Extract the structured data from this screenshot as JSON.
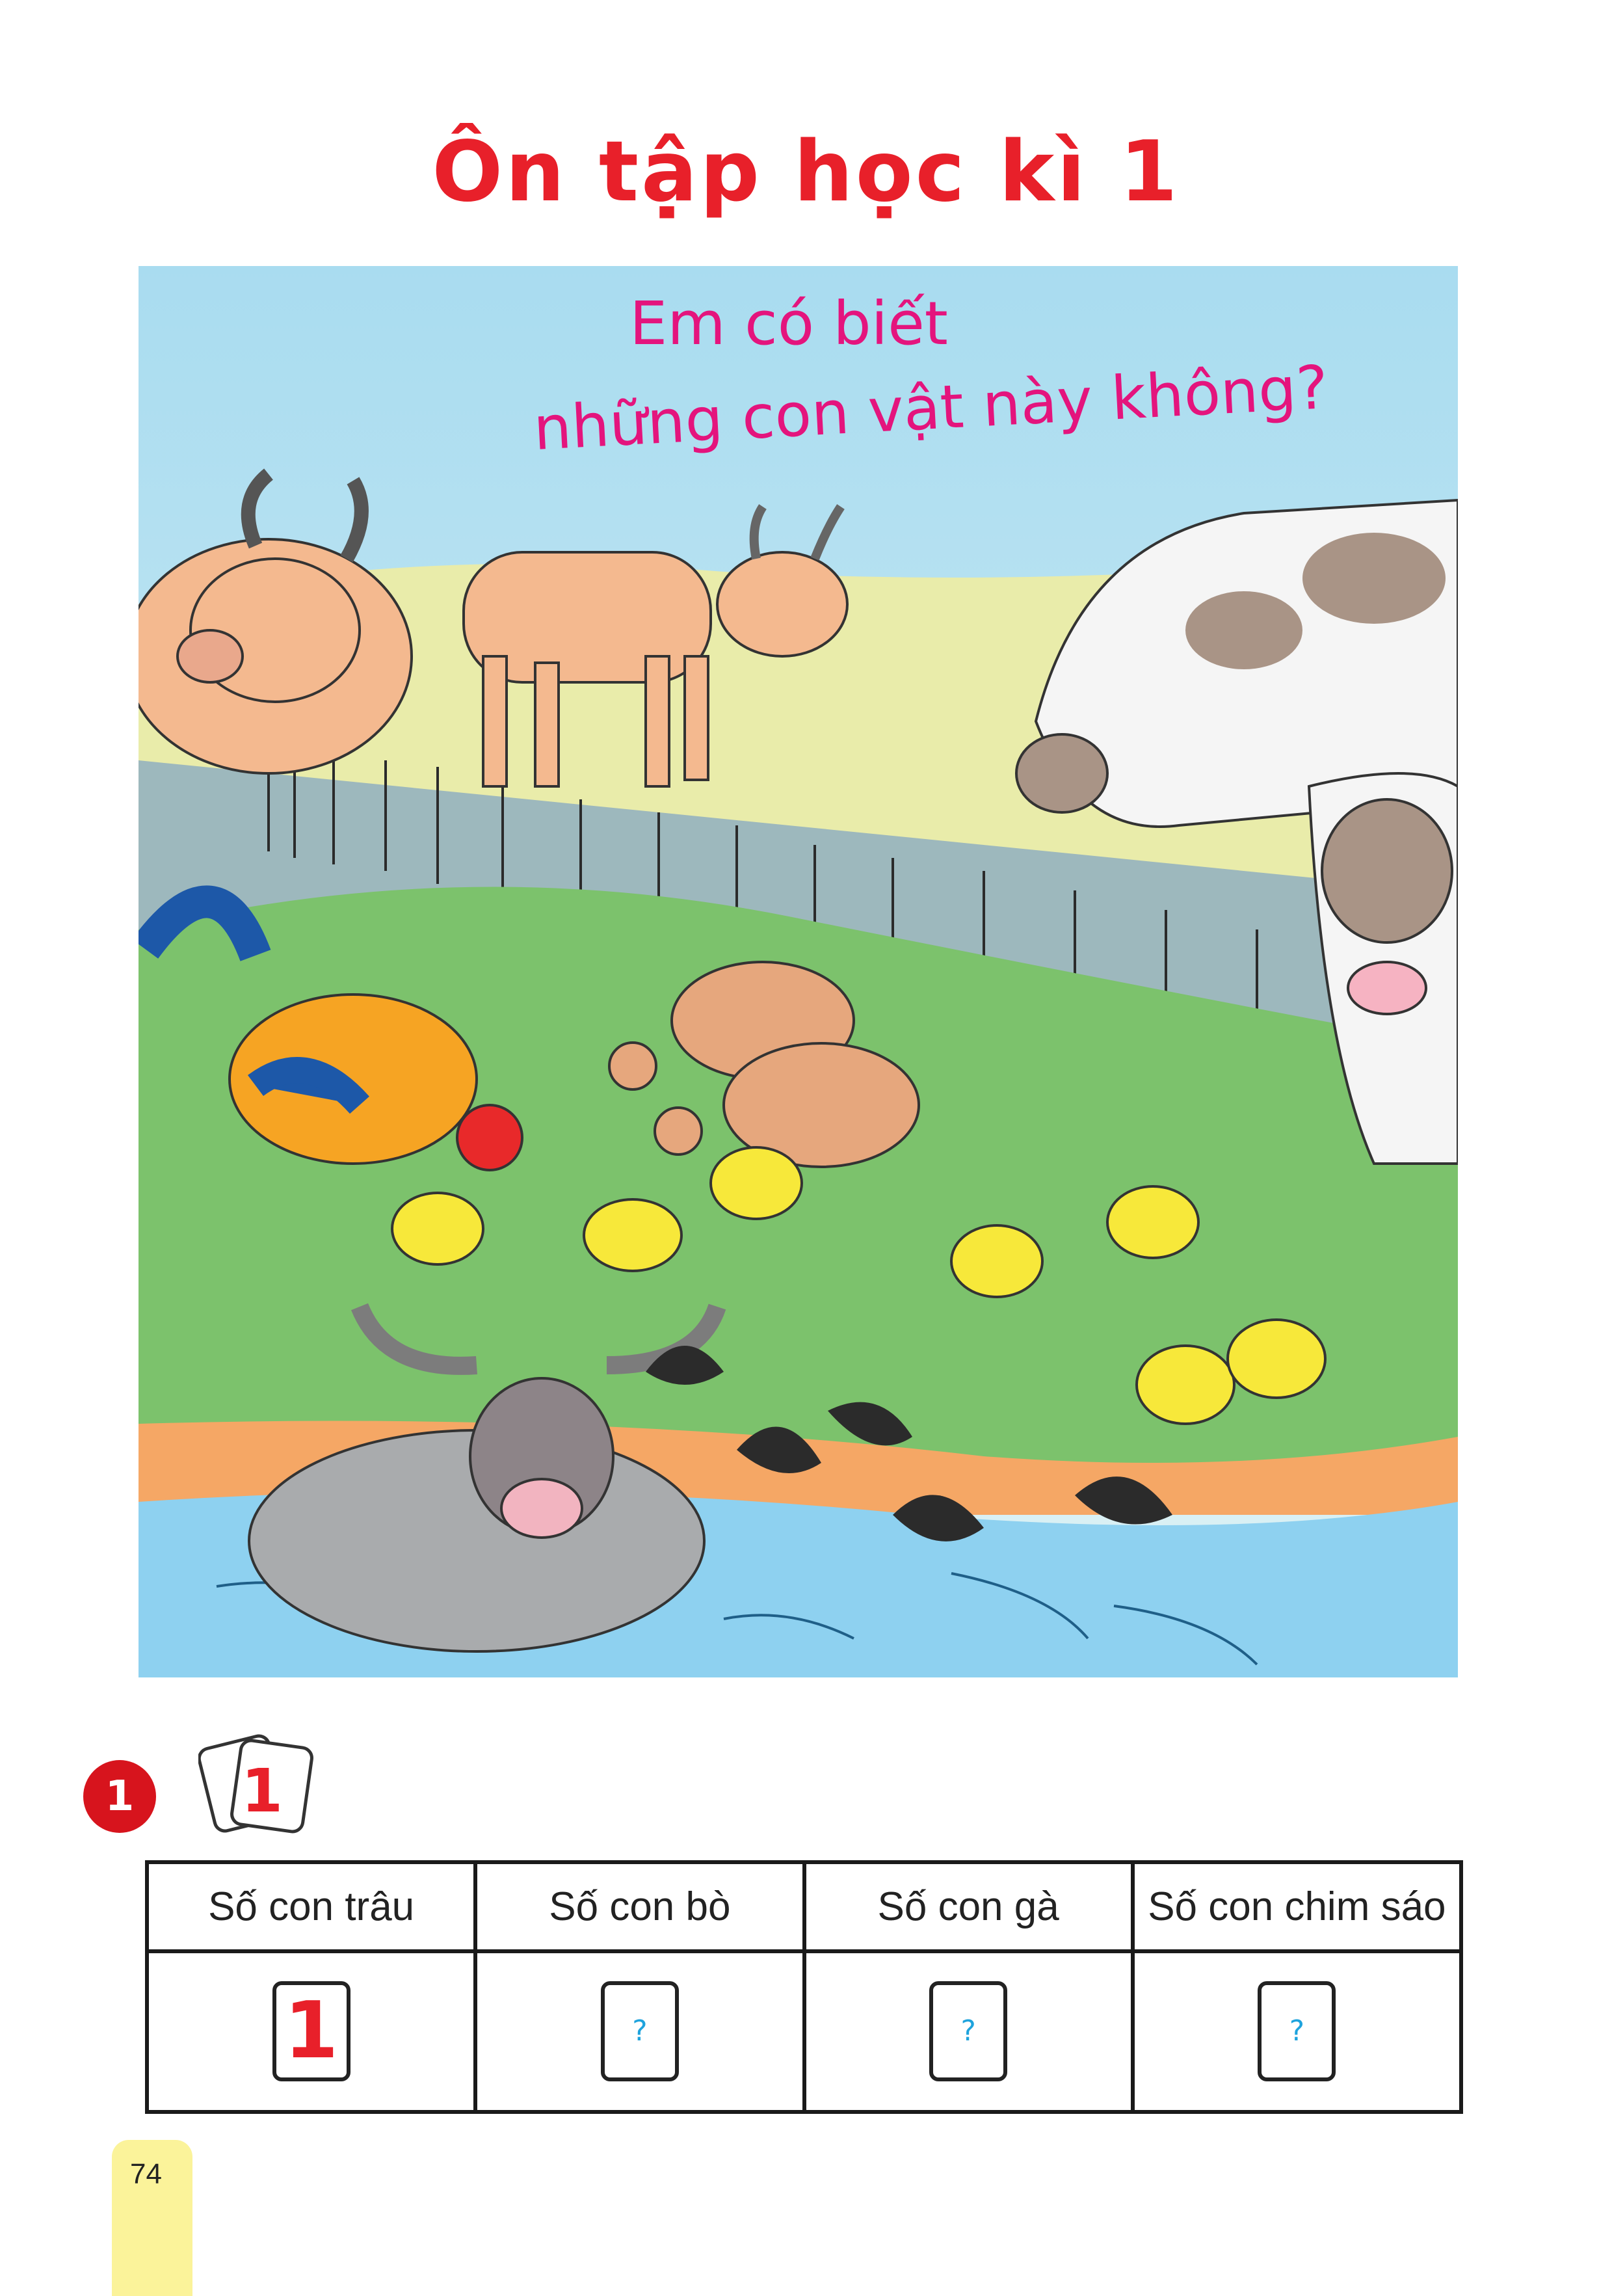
{
  "page": {
    "title": "Ôn tập học kì 1",
    "page_number": "74"
  },
  "illustration": {
    "caption_line1": "Em có biết",
    "caption_line2": "những con vật này không?",
    "colors": {
      "sky": "#bfe4f2",
      "field": "#e9ecaa",
      "grass": "#7cc26c",
      "water": "#8ed1f0",
      "caption": "#e4147d"
    }
  },
  "exercise": {
    "number": "1",
    "card_icon_text": "1",
    "headers": [
      "Số con trâu",
      "Số con bò",
      "Số con gà",
      "Số con chim sáo"
    ],
    "answers": [
      "1",
      "?",
      "?",
      "?"
    ]
  }
}
